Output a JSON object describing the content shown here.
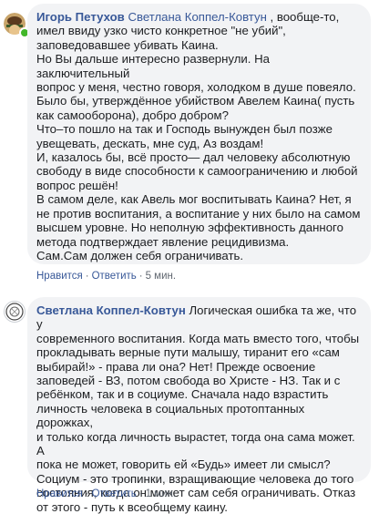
{
  "colors": {
    "link": "#385898",
    "bubble_bg": "#f2f3f5",
    "meta_text": "#606770",
    "online": "#42b72a"
  },
  "comments": [
    {
      "author": "Игорь Петухов",
      "avatar_icon": "user-avatar-icon",
      "online": true,
      "mention": "Светлана Коппел-Ковтун",
      "lines": [
        "Игорь Петухов Светлана Коппел-Ковтун , вообще-то,",
        "имел ввиду узко чисто конкретное \"не убий\",",
        "заповедовавшее убивать Каина.",
        "Но Вы дальше интересно развернули. На заключительный",
        "вопрос у меня, честно говоря, холодком в душе повеяло.",
        "Было бы, утверждённое убийством Авелем Каина( пусть",
        "как самооборона), добро добром?",
        "Что–то пошло на так и Господь вынужден был позже",
        "увещевать, дескать, мне суд, Аз воздам!",
        "И, казалось бы, всё просто— дал человеку абсолютную",
        "свободу в виде способности к самоограничению и любой",
        "вопрос решён!",
        "В самом деле, как Авель мог воспитывать Каина? Нет, я",
        "не против воспитания, а воспитание у них было на самом",
        "высшем уровне. Но неполную эффективность данного",
        "метода подтверждает явление рецидивизма.",
        "Сам.Сам должен себя ограничивать."
      ],
      "first_line_rest": " , вообще-то,",
      "actions": {
        "like": "Нравится",
        "reply": "Ответить",
        "time": "5 мин."
      }
    },
    {
      "author": "Светлана Коппел-Ковтун",
      "avatar_icon": "user-avatar-icon",
      "online": false,
      "first_line_rest": " Логическая ошибка та же, что у",
      "lines": [
        "современного воспитания. Когда мать вместо того, чтобы",
        "прокладывать верные пути малышу, тиранит его «сам",
        "выбирай!» - права ли она? Нет! Прежде освоение",
        "заповедей - ВЗ, потом свобода во Христе - НЗ. Так и с",
        "ребёнком, так и в социуме. Сначала надо взрастить",
        "личность человека в социальных протоптанных дорожках,",
        "и только когда личность вырастет, тогда она сама может. А",
        "пока не может, говорить ей «Будь» имеет ли смысл?",
        "Социум - это тропинки, взращивающие человека до того",
        "состояния, когда он может сам себя ограничивать. Отказ",
        "от этого - путь к всеобщему каину."
      ],
      "actions": {
        "like": "Нравится",
        "reply": "Ответить",
        "time": "1 мин."
      }
    }
  ]
}
